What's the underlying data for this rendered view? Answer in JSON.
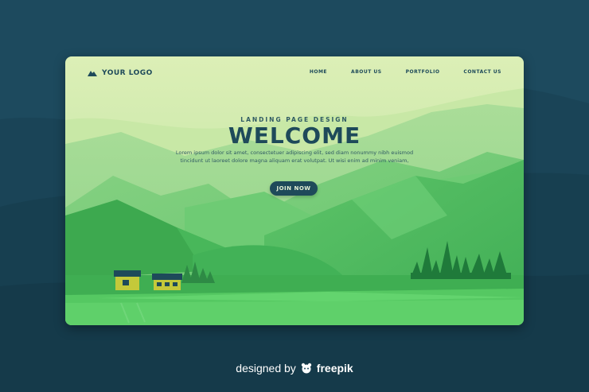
{
  "logo": {
    "text": "YOUR LOGO",
    "icon": "mountain-icon"
  },
  "nav": {
    "items": [
      "HOME",
      "ABOUT US",
      "PORTFOLIO",
      "CONTACT US"
    ]
  },
  "hero": {
    "subtitle": "LANDING PAGE DESIGN",
    "title": "WELCOME",
    "body_line1": "Lorem ipsum dolor sit amet, consectetuer adipiscing elit, sed diam nonummy nibh euismod",
    "body_line2": "tincidunt ut laoreet dolore magna aliquam erat volutpat. Ut wisi enim ad minim veniam,",
    "cta_label": "JOIN NOW"
  },
  "credit": {
    "prefix": "designed by",
    "brand": "freepik",
    "icon": "freepik-icon"
  },
  "colors": {
    "page_bg": "#1d4a5e",
    "text_dark": "#1e4a5a",
    "sky_top": "#d6ecb0",
    "grass": "#4fc35a",
    "forest": "#1f7a3a"
  }
}
